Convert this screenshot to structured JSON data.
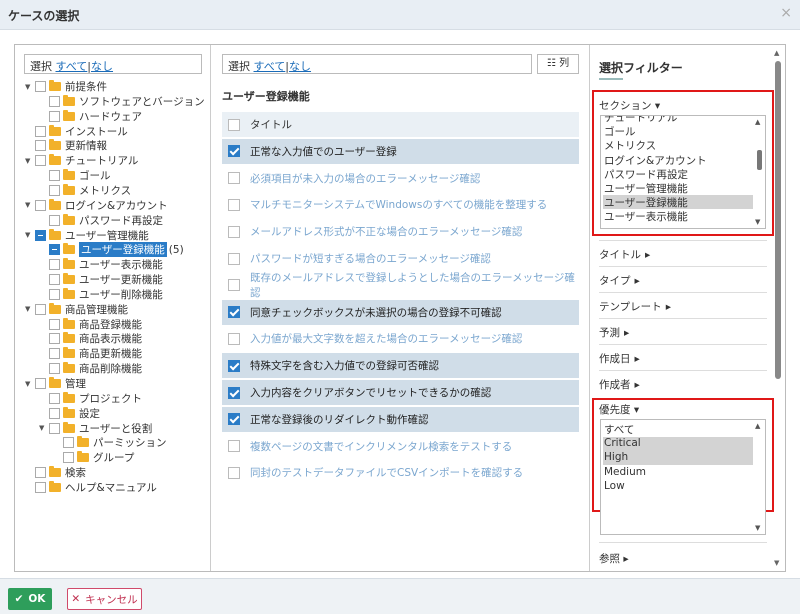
{
  "dialog": {
    "title": "ケースの選択",
    "close_icon": "×"
  },
  "selector": {
    "prefix": "選択",
    "all": "すべて",
    "sep": "|",
    "none": "なし"
  },
  "tree": [
    {
      "label": "前提条件",
      "level": 1,
      "toggle": "▼"
    },
    {
      "label": "ソフトウェアとバージョン",
      "level": 2
    },
    {
      "label": "ハードウェア",
      "level": 2
    },
    {
      "label": "インストール",
      "level": 1
    },
    {
      "label": "更新情報",
      "level": 1
    },
    {
      "label": "チュートリアル",
      "level": 1,
      "toggle": "▼"
    },
    {
      "label": "ゴール",
      "level": 2
    },
    {
      "label": "メトリクス",
      "level": 2
    },
    {
      "label": "ログイン&アカウント",
      "level": 1,
      "toggle": "▼"
    },
    {
      "label": "パスワード再設定",
      "level": 2
    },
    {
      "label": "ユーザー管理機能",
      "level": 1,
      "toggle": "▼",
      "partial": true
    },
    {
      "label": "ユーザー登録機能",
      "level": 2,
      "selected": true,
      "count": "(5)",
      "partial": true
    },
    {
      "label": "ユーザー表示機能",
      "level": 2
    },
    {
      "label": "ユーザー更新機能",
      "level": 2
    },
    {
      "label": "ユーザー削除機能",
      "level": 2
    },
    {
      "label": "商品管理機能",
      "level": 1,
      "toggle": "▼"
    },
    {
      "label": "商品登録機能",
      "level": 2
    },
    {
      "label": "商品表示機能",
      "level": 2
    },
    {
      "label": "商品更新機能",
      "level": 2
    },
    {
      "label": "商品削除機能",
      "level": 2
    },
    {
      "label": "管理",
      "level": 1,
      "toggle": "▼"
    },
    {
      "label": "プロジェクト",
      "level": 2
    },
    {
      "label": "設定",
      "level": 2
    },
    {
      "label": "ユーザーと役割",
      "level": 2,
      "toggle": "▼"
    },
    {
      "label": "パーミッション",
      "level": 3
    },
    {
      "label": "グループ",
      "level": 3
    },
    {
      "label": "検索",
      "level": 1
    },
    {
      "label": "ヘルプ&マニュアル",
      "level": 1
    }
  ],
  "middle": {
    "columns_button": "列",
    "columns_icon": "☷",
    "section_title": "ユーザー登録機能",
    "cases": [
      {
        "label": "タイトル",
        "state": "header"
      },
      {
        "label": "正常な入力値でのユーザー登録",
        "state": "checked"
      },
      {
        "label": "必須項目が未入力の場合のエラーメッセージ確認",
        "state": "unchecked"
      },
      {
        "label": "マルチモニターシステムでWindowsのすべての機能を整理する",
        "state": "unchecked"
      },
      {
        "label": "メールアドレス形式が不正な場合のエラーメッセージ確認",
        "state": "unchecked"
      },
      {
        "label": "パスワードが短すぎる場合のエラーメッセージ確認",
        "state": "unchecked"
      },
      {
        "label": "既存のメールアドレスで登録しようとした場合のエラーメッセージ確認",
        "state": "unchecked"
      },
      {
        "label": "同意チェックボックスが未選択の場合の登録不可確認",
        "state": "checked"
      },
      {
        "label": "入力値が最大文字数を超えた場合のエラーメッセージ確認",
        "state": "unchecked"
      },
      {
        "label": "特殊文字を含む入力値での登録可否確認",
        "state": "checked"
      },
      {
        "label": "入力内容をクリアボタンでリセットできるかの確認",
        "state": "checked"
      },
      {
        "label": "正常な登録後のリダイレクト動作確認",
        "state": "checked"
      },
      {
        "label": "複数ページの文書でインクリメンタル検索をテストする",
        "state": "unchecked"
      },
      {
        "label": "同封のテストデータファイルでCSVインポートを確認する",
        "state": "unchecked"
      }
    ]
  },
  "filter": {
    "title": "選択フィルター",
    "section_label": "セクション",
    "section_items": [
      {
        "label": "チュートリアル"
      },
      {
        "label": "ゴール"
      },
      {
        "label": "メトリクス"
      },
      {
        "label": "ログイン&アカウント"
      },
      {
        "label": "パスワード再設定"
      },
      {
        "label": "ユーザー管理機能"
      },
      {
        "label": "ユーザー登録機能",
        "selected": true
      },
      {
        "label": "ユーザー表示機能"
      }
    ],
    "fields": [
      "タイトル",
      "タイプ",
      "テンプレート",
      "予測",
      "作成日",
      "作成者"
    ],
    "priority_label": "優先度",
    "priority_items": [
      {
        "label": "すべて"
      },
      {
        "label": "Critical",
        "selected": true
      },
      {
        "label": "High",
        "selected": true
      },
      {
        "label": "Medium"
      },
      {
        "label": "Low"
      }
    ],
    "ref_label": "参照",
    "caret_down": "▾",
    "caret_right": "▸",
    "highlight_color": "#e01818"
  },
  "footer": {
    "ok": "OK",
    "ok_icon": "✔",
    "cancel": "キャンセル",
    "cancel_icon": "✕"
  }
}
